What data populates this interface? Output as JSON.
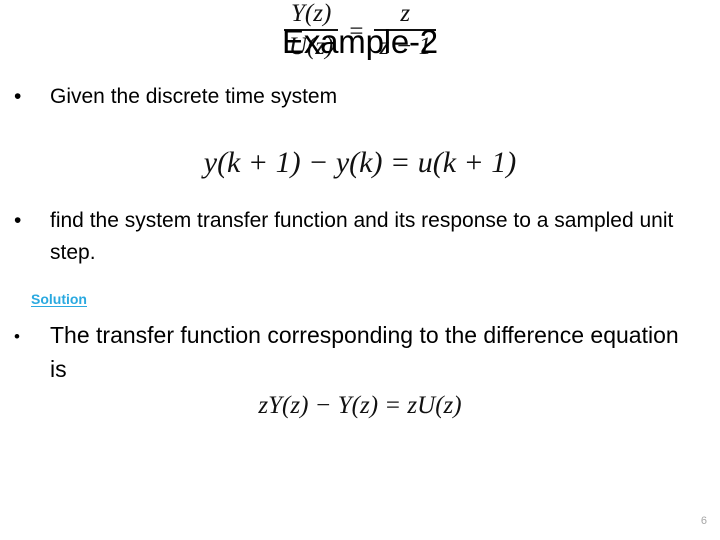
{
  "slide": {
    "title": "Example-2",
    "page_number": "6",
    "accent_color": "#2aa9e0",
    "background_color": "#ffffff",
    "text_color": "#000000"
  },
  "bullets": [
    {
      "marker": "•",
      "text": "Given the discrete time system"
    },
    {
      "marker": "•",
      "text": "find the system transfer function and its response to a sampled unit step."
    },
    {
      "marker": "•",
      "text": "The transfer function corresponding to the difference equation is"
    }
  ],
  "solution": {
    "label": "Solution"
  },
  "equations": {
    "difference_equation": "y(k + 1) − y(k) = u(k + 1)",
    "z_transform_equation": "zY(z) − Y(z) = zU(z)",
    "transfer_function": {
      "left_numerator": "Y(z)",
      "left_denominator": "U(z)",
      "equals": "=",
      "right_numerator": "z",
      "right_denominator": "z − 1"
    }
  }
}
